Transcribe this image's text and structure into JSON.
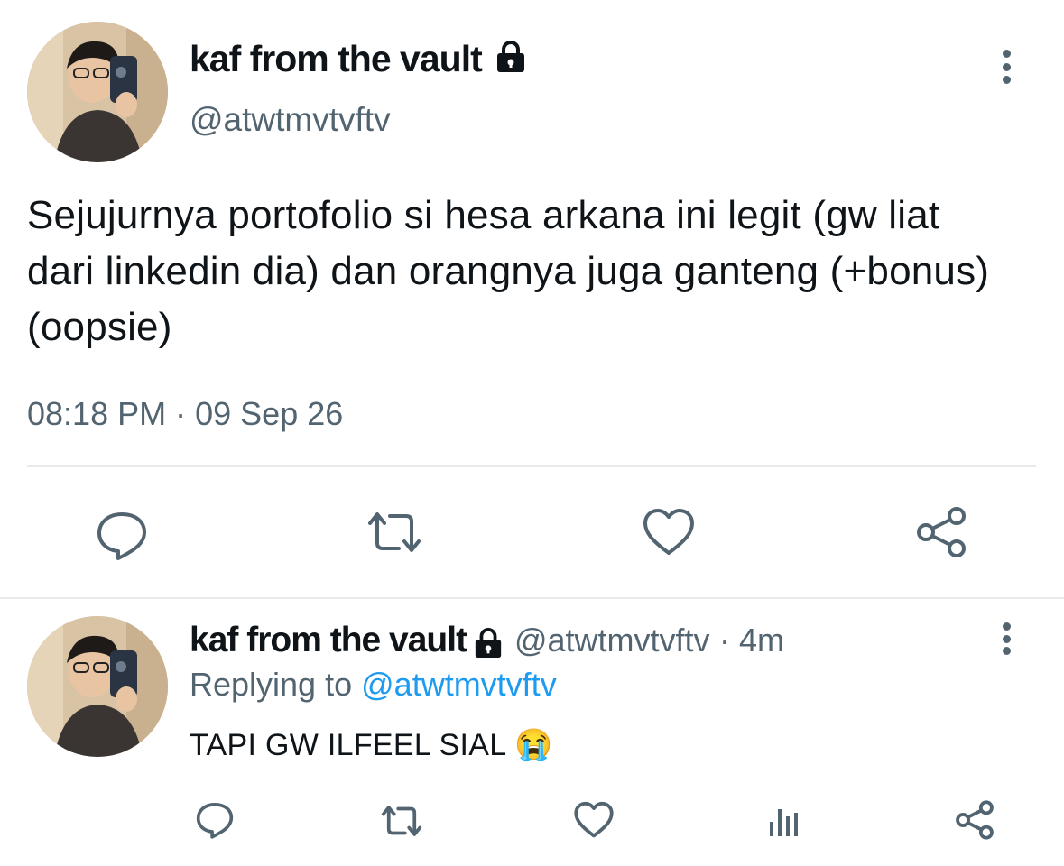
{
  "tweet": {
    "author_name": "kaf from the vault",
    "author_handle": "@atwtmvtvftv",
    "text": "Sejujurnya portofolio si hesa arkana ini legit (gw liat dari linkedin dia) dan orangnya juga ganteng (+bonus) (oopsie)",
    "time": "08:18 PM",
    "separator": "·",
    "date": "09 Sep 26",
    "actions": [
      "reply-icon",
      "retweet-icon",
      "like-icon",
      "share-icon"
    ]
  },
  "reply": {
    "author_name": "kaf from the vault",
    "author_handle": "@atwtmvtvftv",
    "age": "· 4m",
    "replying_prefix": "Replying to",
    "replying_to": "@atwtmvtvftv",
    "text": "TAPI GW ILFEEL SIAL",
    "emoji": "😭",
    "actions": [
      "reply-icon",
      "retweet-icon",
      "like-icon",
      "analytics-icon",
      "share-icon"
    ]
  },
  "colors": {
    "text_primary": "#0f1419",
    "text_secondary": "#536471",
    "link": "#1d9bf0",
    "divider": "#e7e9ea"
  }
}
